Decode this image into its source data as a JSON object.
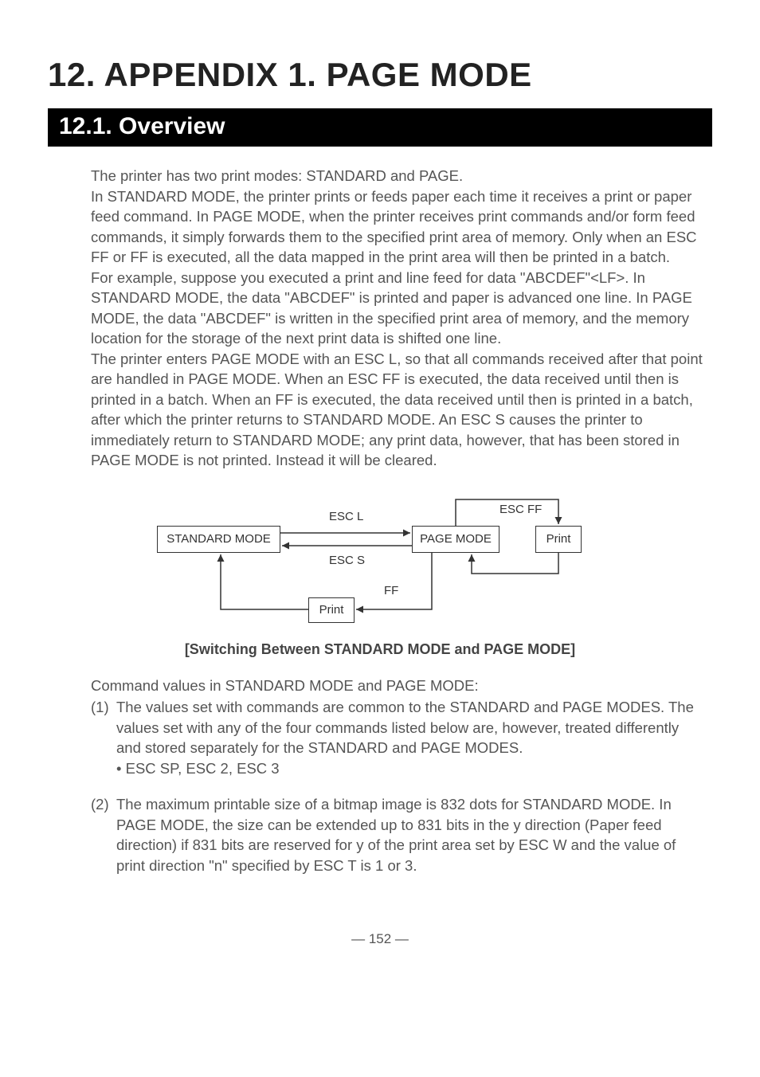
{
  "heading": "12. APPENDIX 1. PAGE MODE",
  "subheading": "12.1. Overview",
  "para1": "The printer has two print modes: STANDARD and PAGE.",
  "para2": "In STANDARD MODE, the printer prints or feeds paper each time it receives a print or paper feed command. In PAGE MODE, when the printer receives print commands and/or form feed commands, it simply forwards them to the specified print area of memory. Only when an ESC FF or FF is executed, all the data mapped in the print area will then be printed in a batch.",
  "para3": "For example, suppose you executed a print and line feed for data \"ABCDEF\"<LF>. In STANDARD MODE, the data \"ABCDEF\" is printed and paper is advanced one line. In PAGE MODE, the data \"ABCDEF\" is written in the specified print area of memory, and the memory location for the storage of the next print data is shifted one line.",
  "para4": "The printer enters PAGE MODE with an ESC L, so that all commands received after that point are handled in PAGE MODE. When an ESC FF is executed, the data received until then is printed in a batch. When an FF is executed, the data received until then is printed in a batch, after which the printer returns to STANDARD MODE. An ESC S causes the printer to immediately return to STANDARD MODE; any print data, however, that has been stored in PAGE MODE is not printed. Instead it will be cleared.",
  "diagram": {
    "standard_mode": "STANDARD MODE",
    "page_mode": "PAGE MODE",
    "print": "Print",
    "print2": "Print",
    "esc_l": "ESC L",
    "esc_s": "ESC S",
    "esc_ff": "ESC FF",
    "ff": "FF"
  },
  "caption": "[Switching Between STANDARD MODE and PAGE MODE]",
  "list_lead": "Command values in STANDARD MODE and PAGE MODE:",
  "item1_num": "(1)",
  "item1_body": "The values set with commands are common to the STANDARD and PAGE MODES. The values set with any of the four commands listed below are, however, treated differently and stored separately for the STANDARD and PAGE MODES.",
  "item1_bullet": "• ESC SP, ESC 2, ESC 3",
  "item2_num": "(2)",
  "item2_body": "The maximum printable size of a bitmap image is 832 dots for STANDARD MODE. In PAGE MODE, the size can be extended up to 831 bits in the y direction (Paper feed direction) if 831 bits are reserved for y of the print area set by ESC W and the value of print direction \"n\" specified by ESC T is 1 or 3.",
  "page_number": "— 152 —"
}
